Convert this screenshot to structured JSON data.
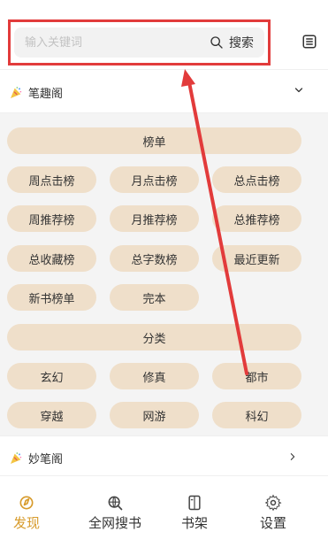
{
  "header": {
    "search_placeholder": "输入关键词",
    "search_button_label": "搜索"
  },
  "sections": [
    {
      "title": "笔趣阁",
      "expanded": true,
      "groups": [
        {
          "title": "榜单",
          "items": [
            "周点击榜",
            "月点击榜",
            "总点击榜",
            "周推荐榜",
            "月推荐榜",
            "总推荐榜",
            "总收藏榜",
            "总字数榜",
            "最近更新",
            "新书榜单",
            "完本"
          ]
        },
        {
          "title": "分类",
          "items": [
            "玄幻",
            "修真",
            "都市",
            "穿越",
            "网游",
            "科幻"
          ]
        }
      ]
    },
    {
      "title": "妙笔阁",
      "expanded": false
    }
  ],
  "bottom_nav": {
    "tabs": [
      {
        "label": "发现",
        "active": true
      },
      {
        "label": "全网搜书",
        "active": false
      },
      {
        "label": "书架",
        "active": false
      },
      {
        "label": "设置",
        "active": false
      }
    ]
  },
  "colors": {
    "accent": "#d79a2a",
    "pill_bg": "#efdfca",
    "highlight_red": "#e23b3b"
  }
}
